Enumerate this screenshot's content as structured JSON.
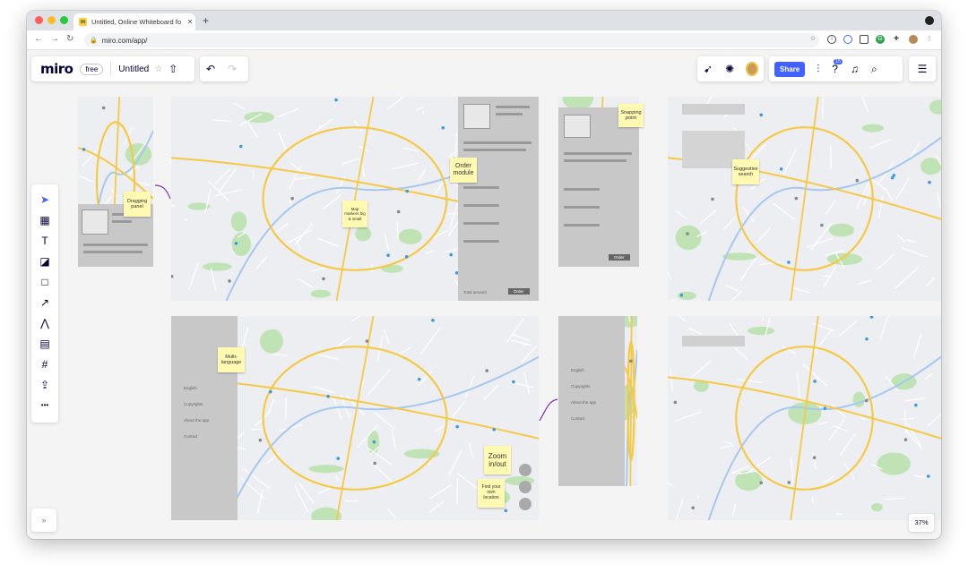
{
  "browser": {
    "tab_title": "Untitled, Online Whiteboard fo",
    "url": "miro.com/app/",
    "traffic_colors": [
      "#ff5f57",
      "#febc2e",
      "#28c840"
    ]
  },
  "app": {
    "logo": "miro",
    "plan": "free",
    "board_name": "Untitled",
    "share_label": "Share",
    "help_badge": "15",
    "zoom_level": "37%",
    "expand_label": "»",
    "accent_color": "#4262ff"
  },
  "toolbar_icons": [
    "select-icon",
    "templates-icon",
    "text-icon",
    "sticky-note-icon",
    "shape-icon",
    "arrow-icon",
    "pen-icon",
    "comment-icon",
    "frame-icon",
    "upload-icon",
    "more-icon"
  ],
  "stickies": {
    "dragging": "Dragging panel",
    "order": "Order module",
    "markers": "Map markers big & small",
    "snapping": "Snapping point",
    "suggestive": "Suggestive search",
    "multilang": "Multi-language",
    "zoom": "Zoom in/out",
    "location": "Find your own location"
  },
  "menu_items": [
    "English",
    "Copyrights",
    "About the app",
    "Contact"
  ],
  "mini_labels": {
    "order_total": "Total amount",
    "order_button": "Order",
    "item": "Main coffee"
  }
}
